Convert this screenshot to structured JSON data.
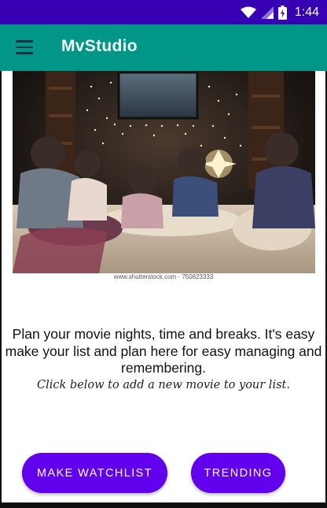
{
  "status_bar": {
    "time": "1:44",
    "icons": [
      "wifi-icon",
      "signal-icon",
      "battery-charging-icon"
    ]
  },
  "app_bar": {
    "title": "MvStudio",
    "menu_icon": "hamburger-menu-icon"
  },
  "hero": {
    "description": "family watching a movie on a couch in a dark living room",
    "credit": "www.shutterstock.com · 750823333"
  },
  "intro_text": "Plan your movie nights, time and breaks. It's easy make your list and plan here for easy managing and remembering.",
  "hint_text": "Click below to add a new movie to your list.",
  "buttons": {
    "make_watchlist": "MAKE WATCHLIST",
    "trending": "TRENDING"
  },
  "colors": {
    "status_bar": "#3700b3",
    "app_bar": "#009688",
    "button": "#6200ee"
  }
}
